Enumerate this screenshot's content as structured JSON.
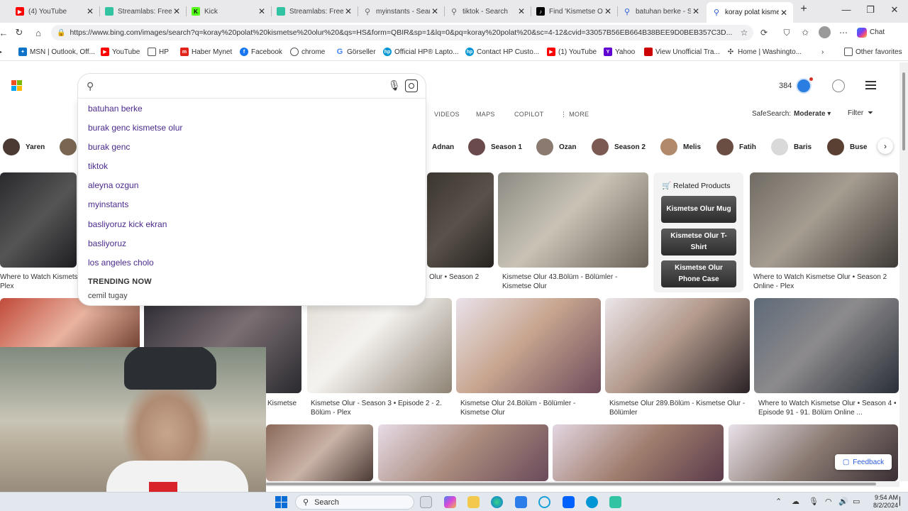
{
  "browser": {
    "tabs": [
      {
        "title": "(4) YouTube",
        "icon": "youtube-icon",
        "color": "#ff0000"
      },
      {
        "title": "Streamlabs: Free Li",
        "icon": "streamlabs-icon",
        "color": "#31c3a2"
      },
      {
        "title": "Kick",
        "icon": "kick-icon",
        "color": "#53fc18"
      },
      {
        "title": "Streamlabs: Free Liv",
        "icon": "streamlabs-icon",
        "color": "#31c3a2"
      },
      {
        "title": "myinstants - Search",
        "icon": "search-icon",
        "color": "#777777"
      },
      {
        "title": "tiktok - Search",
        "icon": "search-icon",
        "color": "#777777"
      },
      {
        "title": "Find 'Kismetse Olur",
        "icon": "tiktok-icon",
        "color": "#000000"
      },
      {
        "title": "batuhan berke - Sea",
        "icon": "search-icon",
        "color": "#2a5bd7"
      },
      {
        "title": "koray polat kismets",
        "icon": "search-icon",
        "color": "#2a5bd7",
        "active": true
      }
    ],
    "new_tab": "+",
    "url": "https://www.bing.com/images/search?q=koray%20polat%20kismetse%20olur%20&qs=HS&form=QBIR&sp=1&lq=0&pq=koray%20polat%20&sc=4-12&cvid=33057B56EB664B38BEE9D0BEB357C3D...",
    "chat_label": "Chat",
    "favorites": [
      {
        "label": "MSN | Outlook, Off...",
        "icon": "msn-icon",
        "color": "#0c73c8"
      },
      {
        "label": "YouTube",
        "icon": "youtube-icon",
        "color": "#ff0000"
      },
      {
        "label": "HP",
        "icon": "folder-icon",
        "color": "#555555"
      },
      {
        "label": "Haber Mynet",
        "icon": "mynet-icon",
        "color": "#e2231a"
      },
      {
        "label": "Facebook",
        "icon": "facebook-icon",
        "color": "#1877f2"
      },
      {
        "label": "chrome",
        "icon": "globe-icon",
        "color": "#555555"
      },
      {
        "label": "Görseller",
        "icon": "google-icon",
        "color": "#4285f4"
      },
      {
        "label": "Official HP® Lapto...",
        "icon": "hp-icon",
        "color": "#0096d6"
      },
      {
        "label": "Contact HP Custo...",
        "icon": "hp-icon",
        "color": "#0096d6"
      },
      {
        "label": "(1) YouTube",
        "icon": "youtube-icon",
        "color": "#ff0000"
      },
      {
        "label": "Yahoo",
        "icon": "yahoo-icon",
        "color": "#6001d2"
      },
      {
        "label": "View Unofficial Tra...",
        "icon": "page-icon",
        "color": "#cc0000"
      },
      {
        "label": "Home | Washingto...",
        "icon": "wp-icon",
        "color": "#333333"
      }
    ],
    "other_favorites": "Other favorites"
  },
  "bing": {
    "search_value": "",
    "suggestions": [
      "batuhan berke",
      "burak genc kismetse olur",
      "burak genc",
      "tiktok",
      "aleyna ozgun",
      "myinstants",
      "basliyoruz kick ekran",
      "basliyoruz",
      "los angeles cholo"
    ],
    "trending_header": "TRENDING NOW",
    "trending": "cemil tugay",
    "rewards_points": "384",
    "nav": [
      "VIDEOS",
      "MAPS",
      "COPILOT",
      "⋮ MORE"
    ],
    "safesearch_label": "SafeSearch:",
    "safesearch_value": "Moderate ▾",
    "filter_label": "Filter",
    "chips": [
      {
        "label": "Yaren",
        "color": "#5b4a42"
      },
      {
        "label": "",
        "color": "#6d5a4a"
      },
      {
        "label": "Adnan",
        "color": ""
      },
      {
        "label": "Season 1",
        "color": "#6a4a4a"
      },
      {
        "label": "Ozan",
        "color": "#8a7a70"
      },
      {
        "label": "Season 2",
        "color": "#7a5a52"
      },
      {
        "label": "Melis",
        "color": "#b08a6a"
      },
      {
        "label": "Fatih",
        "color": "#6a4e44"
      },
      {
        "label": "Baris",
        "color": "#d9d9d9"
      },
      {
        "label": "Buse",
        "color": "#5a4032"
      }
    ],
    "captions": {
      "c1": "Where to Watch Kismetse",
      "c1b": "Plex",
      "c2": "Olur • Season 2",
      "c3": "Kismetse Olur 43.Bölüm - Bölümler -",
      "c3b": "Kismetse Olur",
      "c4": "Where to Watch Kismetse Olur • Season 2",
      "c4b": "Online - Plex",
      "c5": "Kismetse",
      "c6": "Kismetse Olur - Season 3 • Episode 2 - 2.",
      "c6b": "Bölüm - Plex",
      "c7": "Kismetse Olur 24.Bölüm - Bölümler -",
      "c7b": "Kismetse Olur",
      "c8": "Kismetse Olur 289.Bölüm - Kismetse Olur -",
      "c8b": "Bölümler",
      "c9": "Where to Watch Kismetse Olur • Season 4 •",
      "c9b": "Episode 91 - 91. Bölüm Online ..."
    },
    "related_header": "Related Products",
    "related": [
      "Kismetse Olur Mug",
      "Kismetse Olur T-Shirt",
      "Kismetse Olur Phone Case"
    ],
    "feedback": "Feedback"
  },
  "taskbar": {
    "search_label": "Search",
    "time": "9:54 AM",
    "date": "8/2/2024"
  }
}
